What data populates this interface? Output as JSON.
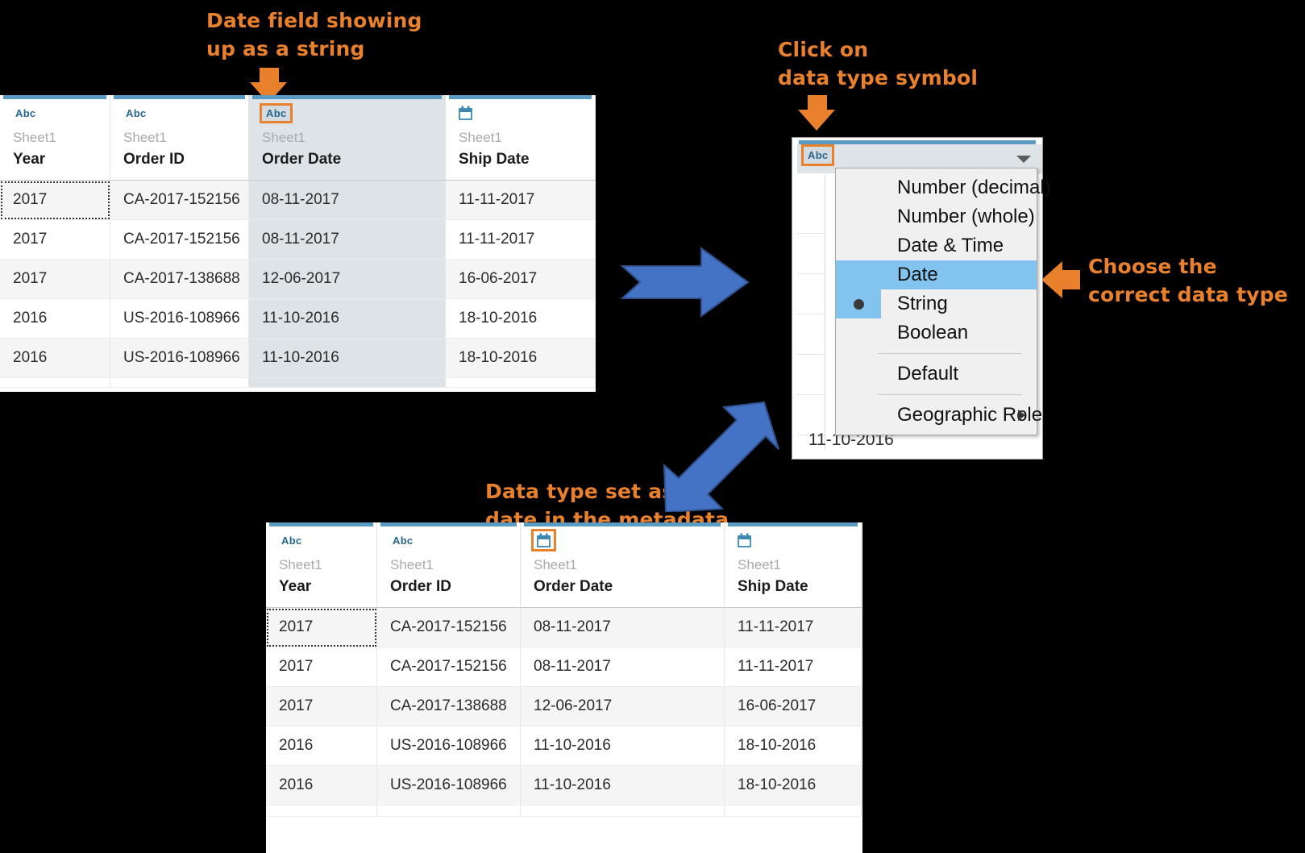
{
  "annotations": {
    "top_left": "Date field showing\nup as a string",
    "top_right": "Click on\ndata type symbol",
    "right_side": "Choose the\ncorrect data type",
    "bottom": "Data type set as\ndate in the metadata"
  },
  "colors": {
    "accent_orange": "#E8802C",
    "arrow_blue": "#4472C4",
    "header_blue": "#5A9BC4",
    "type_text_blue": "#27688F",
    "menu_highlight": "#83C3EF",
    "selected_column": "#DDE3E7"
  },
  "top_grid": {
    "columns": [
      {
        "type_icon": "abc-icon",
        "type_label": "Abc",
        "sheet": "Sheet1",
        "name": "Year",
        "highlighted_icon": false,
        "selected": false
      },
      {
        "type_icon": "abc-icon",
        "type_label": "Abc",
        "sheet": "Sheet1",
        "name": "Order ID",
        "highlighted_icon": false,
        "selected": false
      },
      {
        "type_icon": "abc-icon",
        "type_label": "Abc",
        "sheet": "Sheet1",
        "name": "Order Date",
        "highlighted_icon": true,
        "selected": true
      },
      {
        "type_icon": "calendar-icon",
        "type_label": "",
        "sheet": "Sheet1",
        "name": "Ship Date",
        "highlighted_icon": false,
        "selected": false
      }
    ],
    "rows": [
      [
        "2017",
        "CA-2017-152156",
        "08-11-2017",
        "11-11-2017"
      ],
      [
        "2017",
        "CA-2017-152156",
        "08-11-2017",
        "11-11-2017"
      ],
      [
        "2017",
        "CA-2017-138688",
        "12-06-2017",
        "16-06-2017"
      ],
      [
        "2016",
        "US-2016-108966",
        "11-10-2016",
        "18-10-2016"
      ],
      [
        "2016",
        "US-2016-108966",
        "11-10-2016",
        "18-10-2016"
      ]
    ]
  },
  "mid_panel": {
    "type_label": "Abc",
    "partial_date_text": "11-10-2016",
    "dropdown": {
      "items": [
        {
          "label": "Number (decimal)",
          "highlighted": false,
          "selected": false,
          "submenu": false
        },
        {
          "label": "Number (whole)",
          "highlighted": false,
          "selected": false,
          "submenu": false
        },
        {
          "label": "Date & Time",
          "highlighted": false,
          "selected": false,
          "submenu": false
        },
        {
          "label": "Date",
          "highlighted": true,
          "selected": false,
          "submenu": false
        },
        {
          "label": "String",
          "highlighted": false,
          "selected": true,
          "submenu": false
        },
        {
          "label": "Boolean",
          "highlighted": false,
          "selected": false,
          "submenu": false
        },
        {
          "label": "Default",
          "highlighted": false,
          "selected": false,
          "submenu": false
        },
        {
          "label": "Geographic Role",
          "highlighted": false,
          "selected": false,
          "submenu": true
        }
      ]
    }
  },
  "bottom_grid": {
    "columns": [
      {
        "type_icon": "abc-icon",
        "type_label": "Abc",
        "sheet": "Sheet1",
        "name": "Year",
        "highlighted_icon": false,
        "selected": false
      },
      {
        "type_icon": "abc-icon",
        "type_label": "Abc",
        "sheet": "Sheet1",
        "name": "Order ID",
        "highlighted_icon": false,
        "selected": false
      },
      {
        "type_icon": "calendar-icon",
        "type_label": "",
        "sheet": "Sheet1",
        "name": "Order Date",
        "highlighted_icon": true,
        "selected": false
      },
      {
        "type_icon": "calendar-icon",
        "type_label": "",
        "sheet": "Sheet1",
        "name": "Ship Date",
        "highlighted_icon": false,
        "selected": false
      }
    ],
    "rows": [
      [
        "2017",
        "CA-2017-152156",
        "08-11-2017",
        "11-11-2017"
      ],
      [
        "2017",
        "CA-2017-152156",
        "08-11-2017",
        "11-11-2017"
      ],
      [
        "2017",
        "CA-2017-138688",
        "12-06-2017",
        "16-06-2017"
      ],
      [
        "2016",
        "US-2016-108966",
        "11-10-2016",
        "18-10-2016"
      ],
      [
        "2016",
        "US-2016-108966",
        "11-10-2016",
        "18-10-2016"
      ]
    ]
  }
}
